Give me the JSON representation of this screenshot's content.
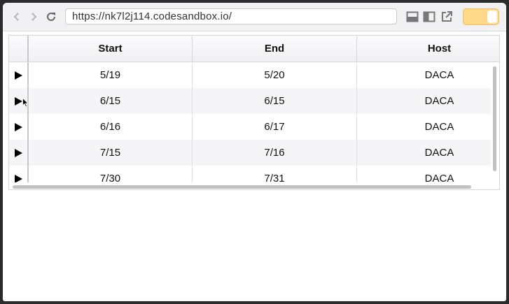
{
  "browser": {
    "url": "https://nk7l2j114.codesandbox.io/",
    "icons": {
      "back": "chevron-left-icon",
      "forward": "chevron-right-icon",
      "reload": "reload-icon",
      "layout_bottom": "layout-bottom-icon",
      "layout_side": "layout-side-icon",
      "open_external": "external-link-icon"
    },
    "toggle_color": "#ffd98a"
  },
  "table": {
    "columns": [
      "Start",
      "End",
      "Host"
    ],
    "rows": [
      {
        "start": "5/19",
        "end": "5/20",
        "host": "DACA"
      },
      {
        "start": "6/15",
        "end": "6/15",
        "host": "DACA"
      },
      {
        "start": "6/16",
        "end": "6/17",
        "host": "DACA"
      },
      {
        "start": "7/15",
        "end": "7/16",
        "host": "DACA"
      },
      {
        "start": "7/30",
        "end": "7/31",
        "host": "DACA"
      }
    ],
    "expander_icon": "play-triangle-icon",
    "alt_row_color": "#f5f5f8"
  }
}
